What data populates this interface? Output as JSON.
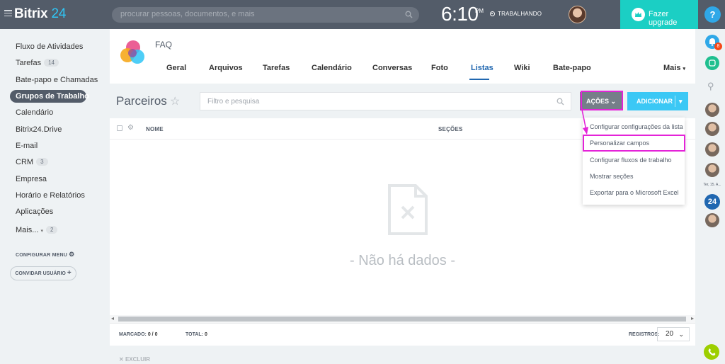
{
  "topbar": {
    "logo": "Bitrix",
    "logo_num": "24",
    "search_placeholder": "procurar pessoas, documentos, e mais",
    "clock": "6:10",
    "ampm": "PM",
    "status": "TRABALHANDO",
    "upgrade": "Fazer upgrade",
    "help": "?"
  },
  "leftnav": {
    "items": [
      {
        "label": "Fluxo de Atividades"
      },
      {
        "label": "Tarefas",
        "count": "14"
      },
      {
        "label": "Bate-papo e Chamadas"
      },
      {
        "label": "Grupos de Trabalho"
      },
      {
        "label": "Calendário"
      },
      {
        "label": "Bitrix24.Drive"
      },
      {
        "label": "E-mail"
      },
      {
        "label": "CRM",
        "count": "3"
      },
      {
        "label": "Empresa"
      },
      {
        "label": "Horário e Relatórios"
      },
      {
        "label": "Aplicações"
      },
      {
        "label": "Mais...",
        "count": "2"
      }
    ],
    "config_menu": "CONFIGURAR MENU",
    "invite": "CONVIDAR USUÁRIO"
  },
  "group": {
    "name": "FAQ",
    "tabs": [
      "Geral",
      "Arquivos",
      "Tarefas",
      "Calendário",
      "Conversas",
      "Foto",
      "Listas",
      "Wiki",
      "Bate-papo"
    ],
    "more": "Mais",
    "active_tab": "Listas"
  },
  "list": {
    "title": "Parceiros",
    "filter_placeholder": "Filtro e pesquisa",
    "actions_button": "AÇÕES",
    "add_button": "ADICIONAR",
    "columns": [
      "NOME",
      "SEÇÕES"
    ],
    "empty": "- Não há dados -",
    "marked_label": "MARCADO:",
    "marked_value": "0 / 0",
    "total_label": "TOTAL:",
    "total_value": "0",
    "records_label": "REGISTROS:",
    "records_value": "20",
    "delete": "EXCLUIR"
  },
  "actions_menu": {
    "items": [
      "Configurar configurações da lista",
      "Personalizar campos",
      "Configurar fluxos de trabalho",
      "Mostrar seções",
      "Exportar para o Microsoft Excel"
    ]
  },
  "rightbar": {
    "notif_count": "8",
    "date_label": "Ter, 15. A...",
    "b24": "24"
  },
  "colors": {
    "topbar": "#535c69",
    "accent": "#3bc8f5",
    "upgrade": "#1bcfc4",
    "highlight": "#e423d8",
    "active_tab": "#2067b0"
  }
}
